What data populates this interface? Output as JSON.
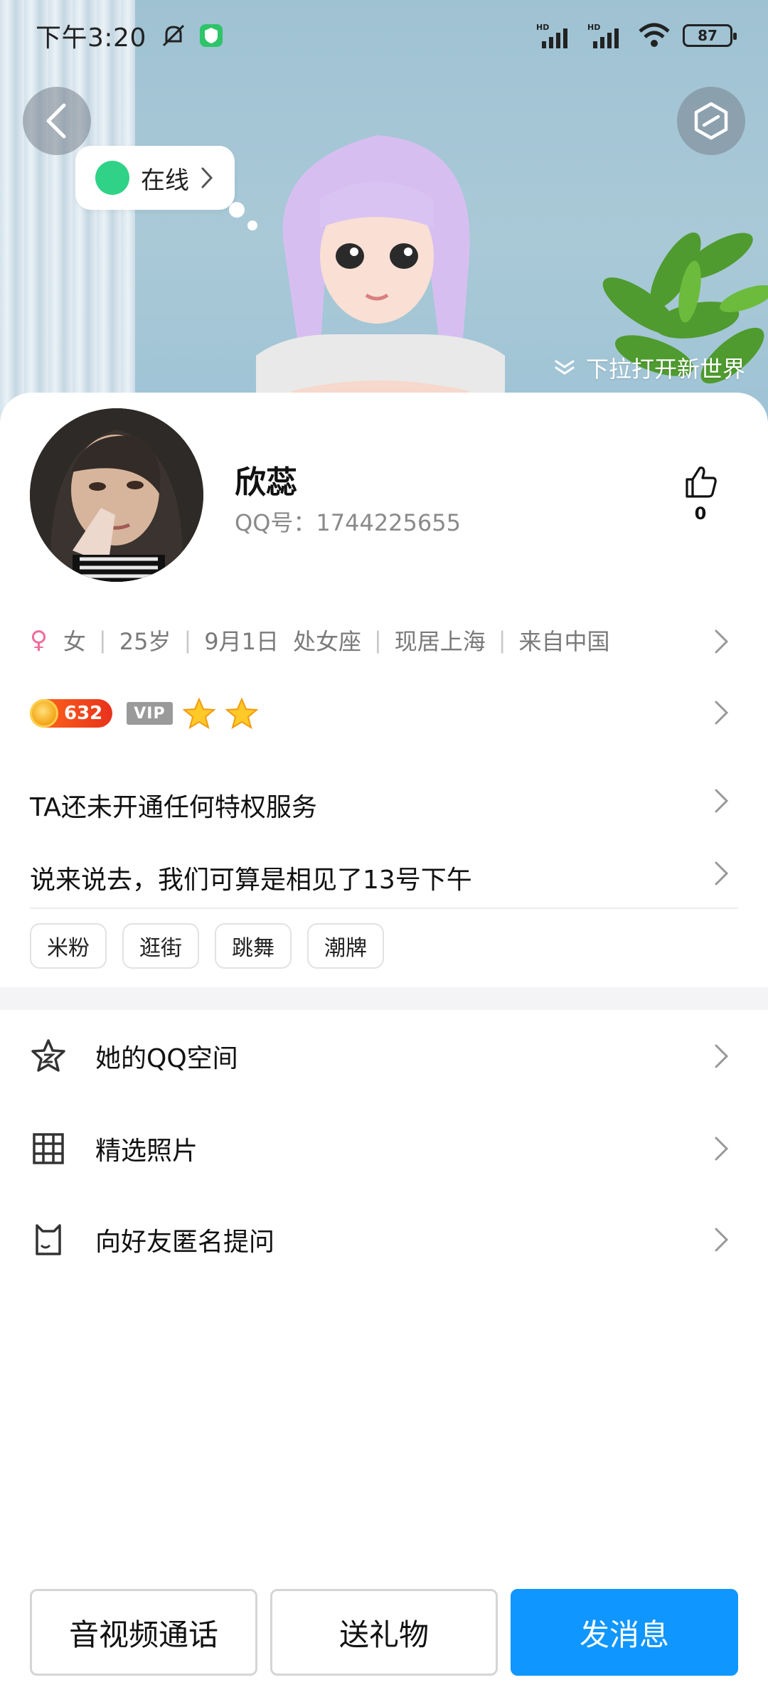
{
  "status_bar": {
    "time": "下午3:20",
    "battery": "87",
    "network_labels": [
      "HD",
      "HD"
    ]
  },
  "hero": {
    "online_status": "在线",
    "pull_hint": "下拉打开新世界"
  },
  "profile": {
    "nickname": "欣蕊",
    "qq_label": "QQ号：1744225655",
    "likes": "0",
    "gender": "女",
    "age": "25岁",
    "birthday": "9月1日",
    "zodiac": "处女座",
    "residence": "现居上海",
    "origin": "来自中国",
    "level_badge": "632",
    "vip_badge": "VIP",
    "privilege_text": "TA还未开通任何特权服务",
    "signature": "说来说去，我们可算是相见了13号下午",
    "tags": [
      "米粉",
      "逛街",
      "跳舞",
      "潮牌"
    ]
  },
  "menu": {
    "items": [
      {
        "label": "她的QQ空间",
        "icon": "qzone-star-icon"
      },
      {
        "label": "精选照片",
        "icon": "photo-grid-icon"
      },
      {
        "label": "向好友匿名提问",
        "icon": "anonymous-question-icon"
      }
    ]
  },
  "actions": {
    "call": "音视频通话",
    "gift": "送礼物",
    "message": "发消息"
  },
  "colors": {
    "primary": "#0f96ff",
    "online": "#2fd286",
    "female": "#f06b9a"
  }
}
